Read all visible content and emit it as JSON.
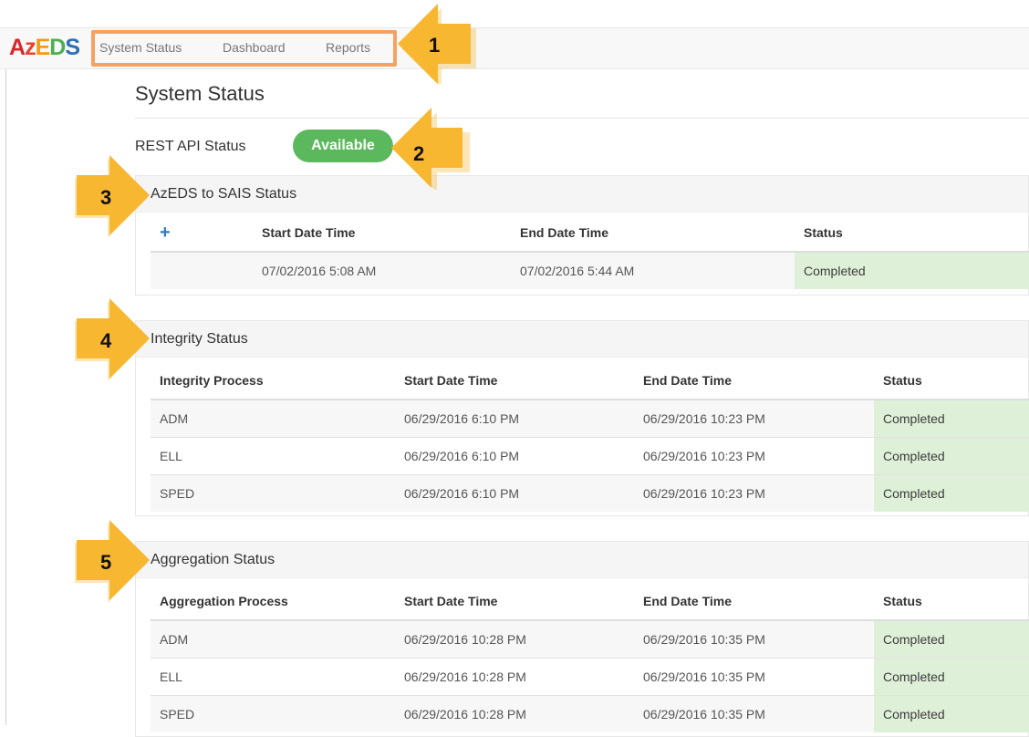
{
  "brand": {
    "letters": [
      "A",
      "z",
      "E",
      "D",
      "S"
    ]
  },
  "nav": {
    "items": [
      "System Status",
      "Dashboard",
      "Reports"
    ]
  },
  "page": {
    "title": "System Status"
  },
  "api": {
    "label": "REST API Status",
    "status": "Available"
  },
  "sais": {
    "heading": "AzEDS to SAIS Status",
    "columns": [
      "Start Date Time",
      "End Date Time",
      "Status"
    ],
    "rows": [
      {
        "start": "07/02/2016 5:08 AM",
        "end": "07/02/2016 5:44 AM",
        "status": "Completed"
      }
    ]
  },
  "integrity": {
    "heading": "Integrity Status",
    "columns": [
      "Integrity Process",
      "Start Date Time",
      "End Date Time",
      "Status"
    ],
    "rows": [
      {
        "process": "ADM",
        "start": "06/29/2016 6:10 PM",
        "end": "06/29/2016 10:23 PM",
        "status": "Completed"
      },
      {
        "process": "ELL",
        "start": "06/29/2016 6:10 PM",
        "end": "06/29/2016 10:23 PM",
        "status": "Completed"
      },
      {
        "process": "SPED",
        "start": "06/29/2016 6:10 PM",
        "end": "06/29/2016 10:23 PM",
        "status": "Completed"
      }
    ]
  },
  "aggregation": {
    "heading": "Aggregation Status",
    "columns": [
      "Aggregation Process",
      "Start Date Time",
      "End Date Time",
      "Status"
    ],
    "rows": [
      {
        "process": "ADM",
        "start": "06/29/2016 10:28 PM",
        "end": "06/29/2016 10:35 PM",
        "status": "Completed"
      },
      {
        "process": "ELL",
        "start": "06/29/2016 10:28 PM",
        "end": "06/29/2016 10:35 PM",
        "status": "Completed"
      },
      {
        "process": "SPED",
        "start": "06/29/2016 10:28 PM",
        "end": "06/29/2016 10:35 PM",
        "status": "Completed"
      }
    ]
  },
  "callouts": [
    "1",
    "2",
    "3",
    "4",
    "5"
  ],
  "colors": {
    "accent": "#f7b731",
    "success": "#5cb85c",
    "completed_bg": "#dff0d8"
  }
}
